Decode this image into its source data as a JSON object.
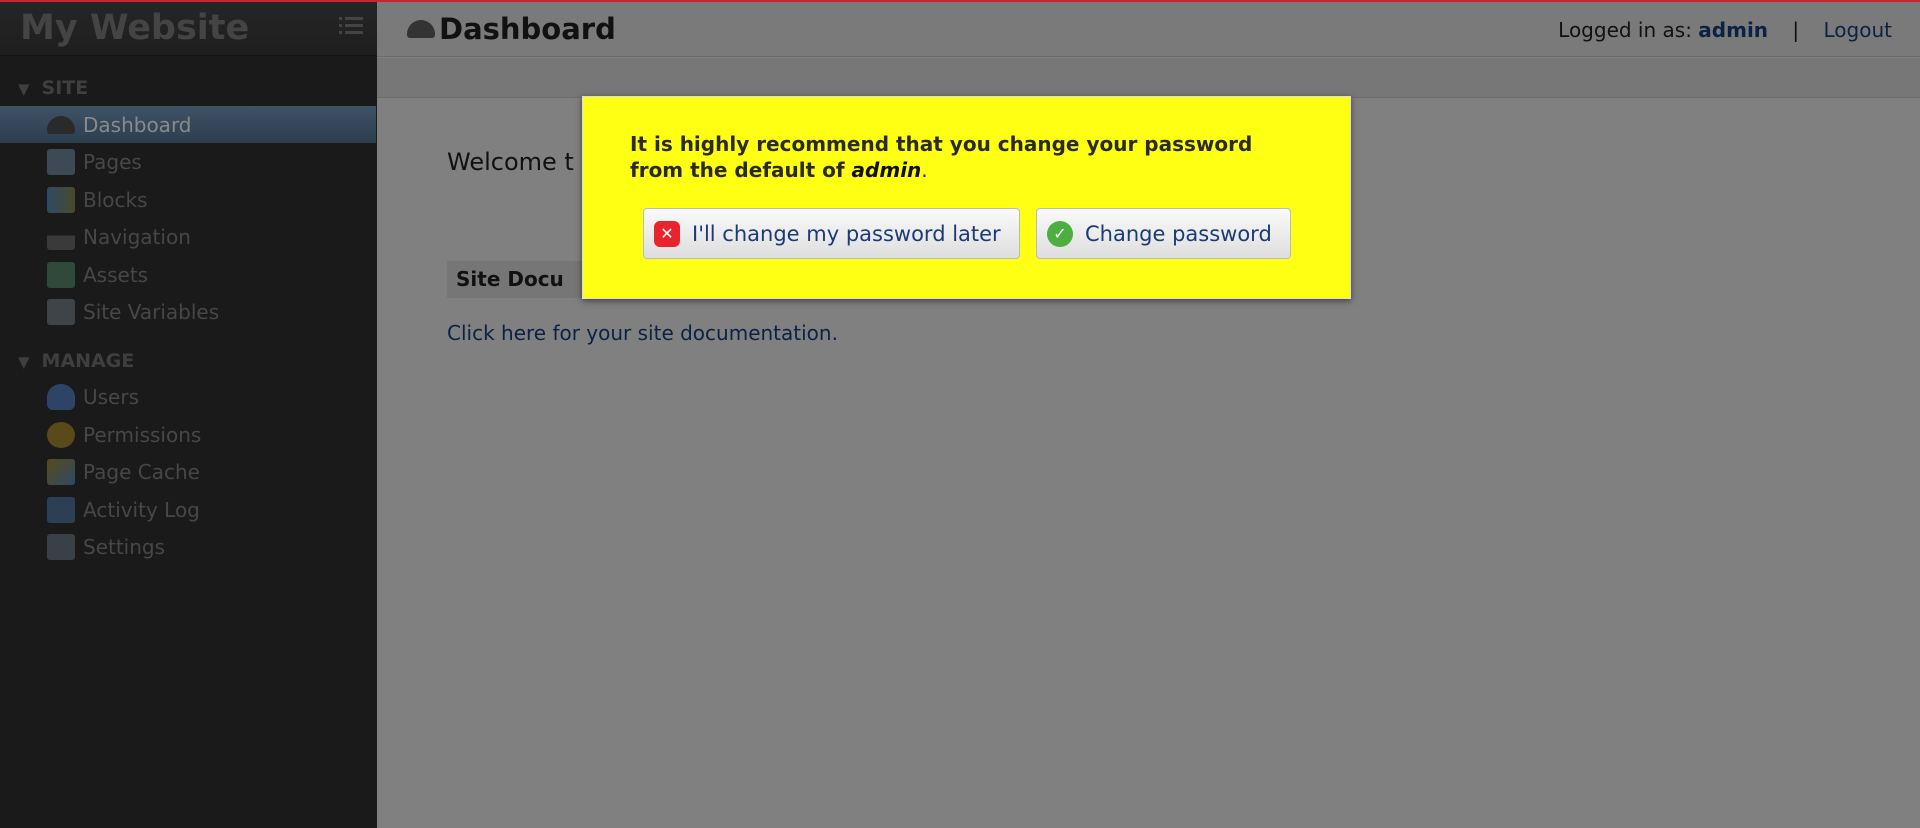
{
  "sidebar": {
    "brand": "My Website",
    "sections": [
      {
        "label": "SITE",
        "items": [
          {
            "label": "Dashboard",
            "icon": "dashboard-gauge-icon",
            "active": true
          },
          {
            "label": "Pages",
            "icon": "pages-icon"
          },
          {
            "label": "Blocks",
            "icon": "blocks-icon"
          },
          {
            "label": "Navigation",
            "icon": "navigation-sitemap-icon"
          },
          {
            "label": "Assets",
            "icon": "assets-icon"
          },
          {
            "label": "Site Variables",
            "icon": "site-variables-icon"
          }
        ]
      },
      {
        "label": "MANAGE",
        "items": [
          {
            "label": "Users",
            "icon": "user-icon"
          },
          {
            "label": "Permissions",
            "icon": "key-icon"
          },
          {
            "label": "Page Cache",
            "icon": "page-cache-icon"
          },
          {
            "label": "Activity Log",
            "icon": "book-icon"
          },
          {
            "label": "Settings",
            "icon": "settings-icon"
          }
        ]
      }
    ]
  },
  "header": {
    "title": "Dashboard",
    "logged_in_label": "Logged in as:",
    "username": "admin",
    "separator": "|",
    "logout": "Logout"
  },
  "main": {
    "welcome": "Welcome t",
    "doc_heading": "Site Docu",
    "doc_link": "Click here for your site documentation."
  },
  "modal": {
    "message": "It is highly recommend that you change your password from the default of ",
    "default_password": "admin",
    "message_end": ".",
    "later_button": "I'll change my password later",
    "change_button": "Change password"
  },
  "colors": {
    "modal_bg": "#ffff13",
    "accent_top": "#c8262d",
    "link": "#0b2245"
  }
}
